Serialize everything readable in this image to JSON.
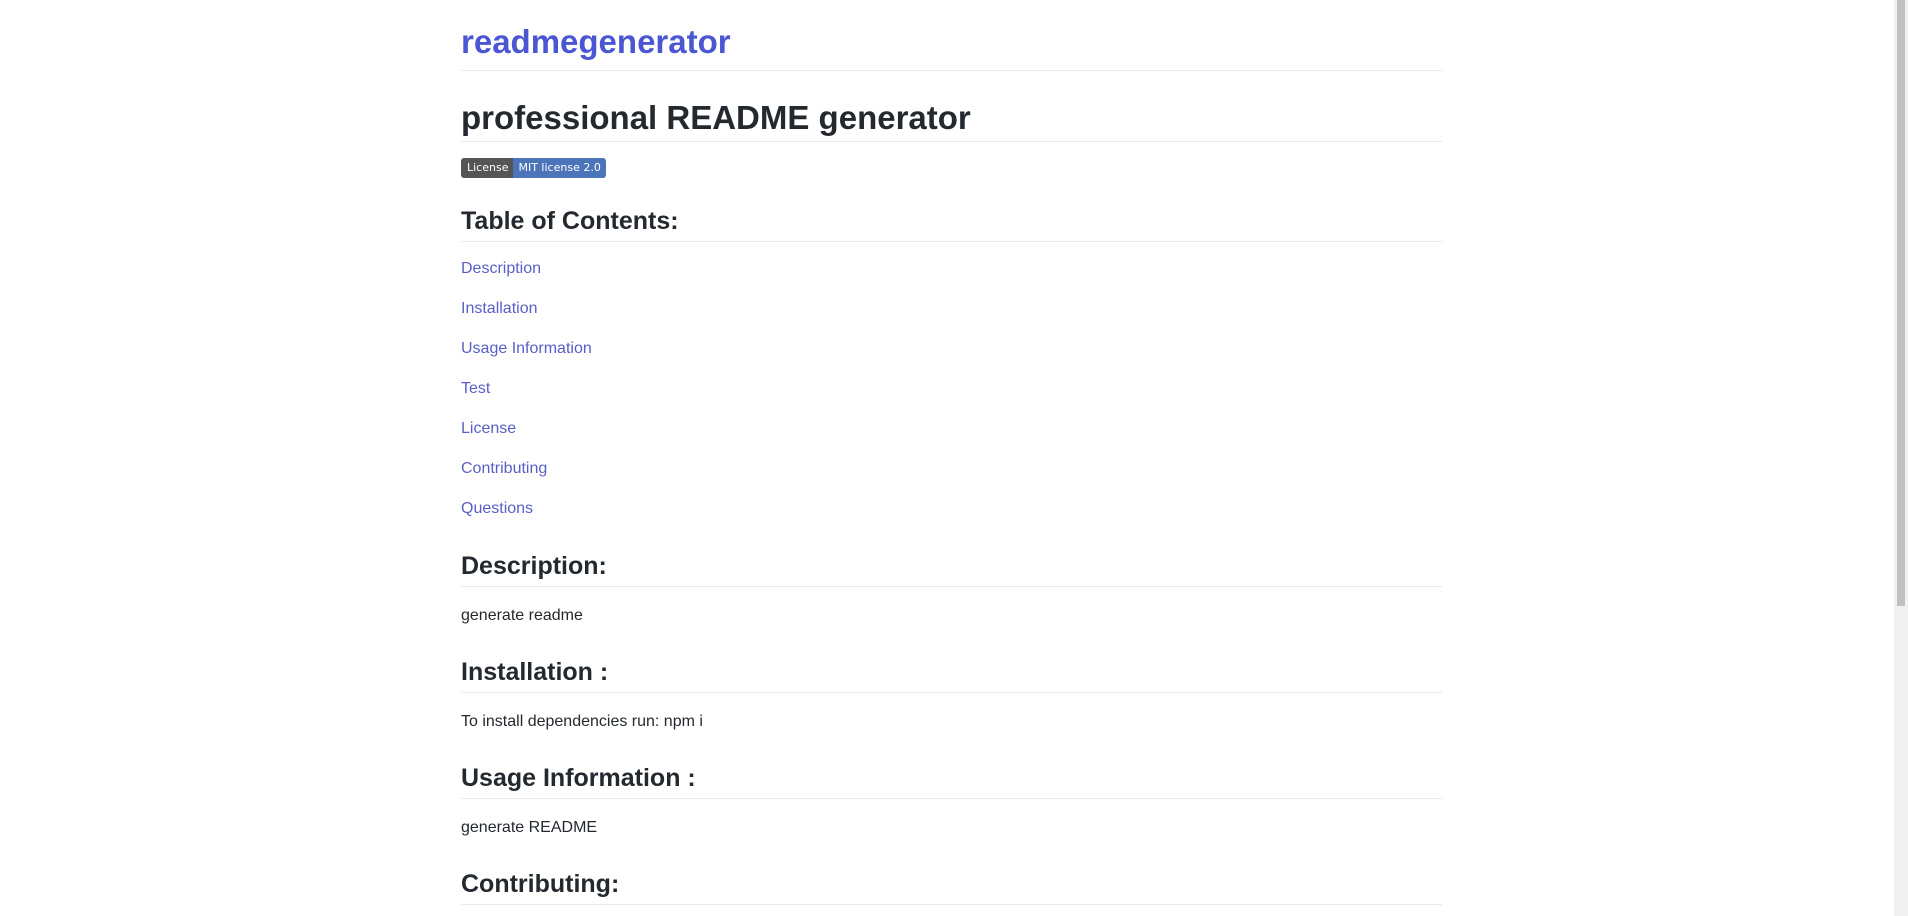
{
  "site": {
    "title": "readmegenerator"
  },
  "readme": {
    "title": "professional README generator",
    "badge": {
      "label": "License",
      "value": "MIT license 2.0",
      "label_color": "#555555",
      "value_color": "#4c74b9"
    },
    "toc": {
      "heading": "Table of Contents:",
      "items": [
        "Description",
        "Installation",
        "Usage Information",
        "Test",
        "License",
        "Contributing",
        "Questions"
      ]
    },
    "sections": {
      "description": {
        "heading": "Description:",
        "body": "generate readme"
      },
      "installation": {
        "heading": "Installation :",
        "body": "To install dependencies run: npm i"
      },
      "usage": {
        "heading": "Usage Information :",
        "body": "generate README"
      },
      "contributing": {
        "heading": "Contributing:"
      }
    }
  },
  "colors": {
    "link": "#5a5fc7",
    "site_title": "#4b56d2",
    "text": "#24292f"
  }
}
